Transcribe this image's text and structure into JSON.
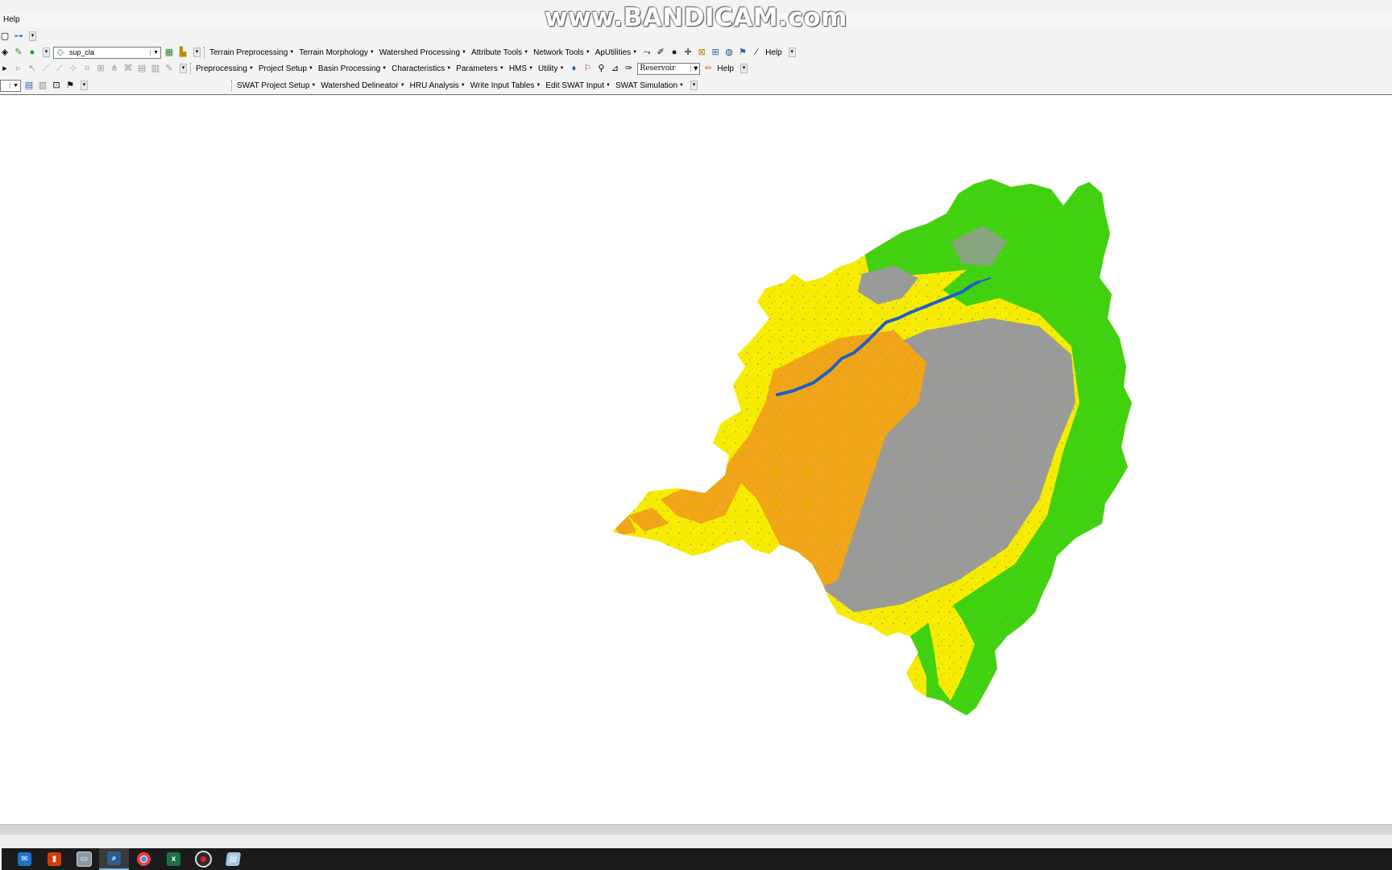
{
  "app": {
    "menu_help": "Help",
    "watermark": "www.BANDICAM.com"
  },
  "toolbar_row1": {
    "layer_combo_value": "sup_cla",
    "menus": [
      "Terrain Preprocessing",
      "Terrain Morphology",
      "Watershed Processing",
      "Attribute Tools",
      "Network Tools",
      "ApUtilities"
    ],
    "help": "Help"
  },
  "toolbar_row2": {
    "menus": [
      "Preprocessing",
      "Project Setup",
      "Basin Processing",
      "Characteristics",
      "Parameters",
      "HMS",
      "Utility"
    ],
    "reservoir_combo_value": "Reservoir",
    "help": "Help"
  },
  "toolbar_row3": {
    "menus": [
      "SWAT Project Setup",
      "Watershed Delineator",
      "HRU Analysis",
      "Write Input Tables",
      "Edit SWAT Input",
      "SWAT Simulation"
    ]
  },
  "map": {
    "layer": "sup_cla",
    "classes": [
      {
        "name": "yellow",
        "color": "#f7ec00"
      },
      {
        "name": "orange",
        "color": "#f2a516"
      },
      {
        "name": "gray",
        "color": "#9a9a9a"
      },
      {
        "name": "green",
        "color": "#3fd20f"
      },
      {
        "name": "water",
        "color": "#1f5fc9"
      }
    ]
  },
  "taskbar": {
    "icons": [
      "mail-icon",
      "office-icon",
      "window-icon",
      "search-app-icon",
      "chrome-icon",
      "excel-icon",
      "record-icon",
      "notes-icon"
    ]
  }
}
